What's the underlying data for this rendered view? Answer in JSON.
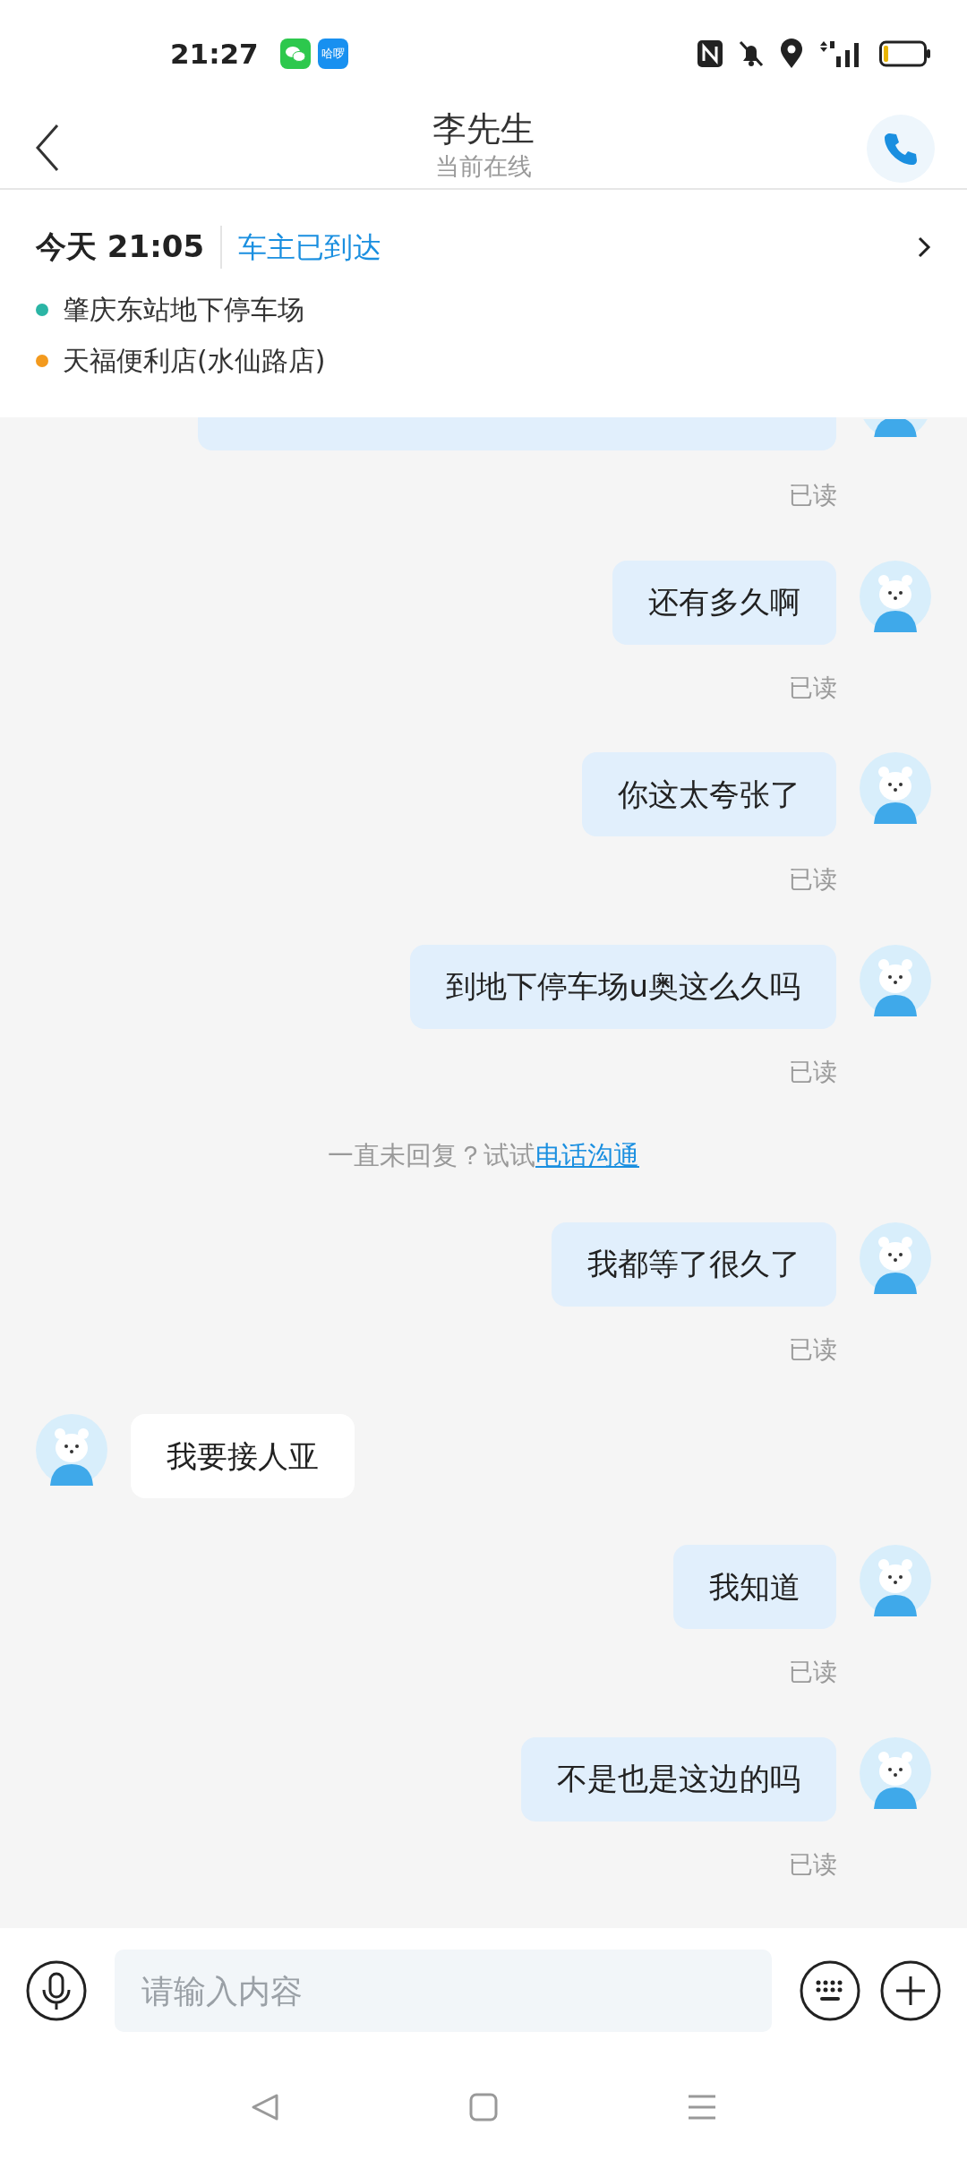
{
  "status_bar": {
    "time": "21:27",
    "app_badge": "哈啰"
  },
  "header": {
    "title": "李先生",
    "subtitle": "当前在线"
  },
  "trip": {
    "date": "今天 21:05",
    "status": "车主已到达",
    "stops": [
      {
        "name": "肇庆东站地下停车场",
        "color": "#2bb5a5"
      },
      {
        "name": "天福便利店(水仙路店)",
        "color": "#f39a1e"
      }
    ]
  },
  "messages": [
    {
      "kind": "partial",
      "read": "已读"
    },
    {
      "kind": "sent",
      "text": "还有多久啊",
      "read": "已读"
    },
    {
      "kind": "sent",
      "text": "你这太夸张了",
      "read": "已读"
    },
    {
      "kind": "sent",
      "text": "到地下停车场u奥这么久吗",
      "read": "已读"
    },
    {
      "kind": "system",
      "text": "一直未回复？试试",
      "link": "电话沟通"
    },
    {
      "kind": "sent",
      "text": "我都等了很久了",
      "read": "已读"
    },
    {
      "kind": "received",
      "text": "我要接人亚"
    },
    {
      "kind": "sent",
      "text": "我知道",
      "read": "已读"
    },
    {
      "kind": "sent",
      "text": "不是也是这边的吗",
      "read": "已读"
    }
  ],
  "composer": {
    "placeholder": "请输入内容"
  }
}
